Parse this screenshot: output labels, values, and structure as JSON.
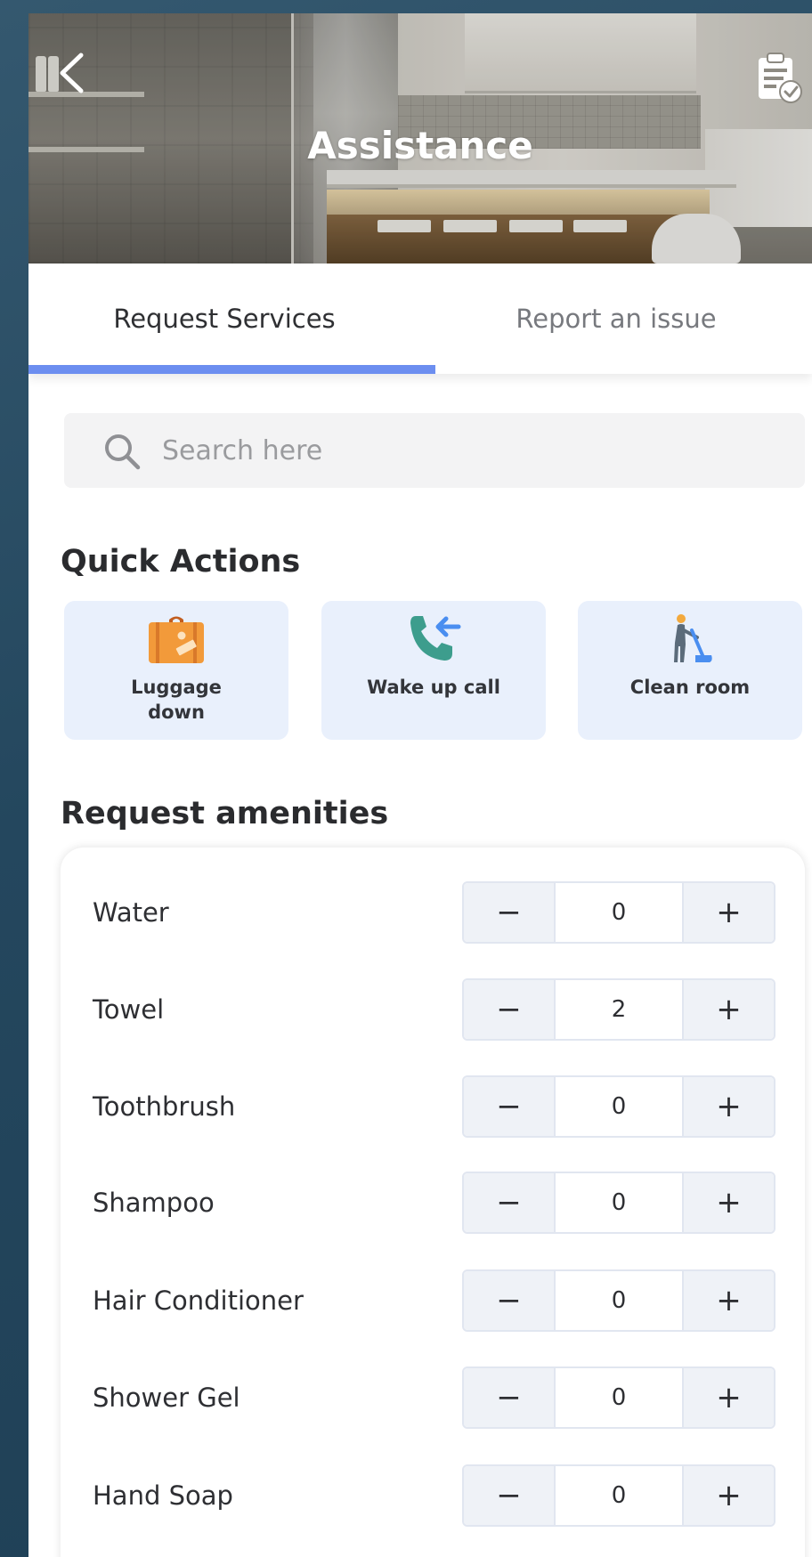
{
  "header": {
    "title": "Assistance",
    "back_icon": "chevron-left-icon",
    "action_icon": "clipboard-check-icon"
  },
  "tabs": [
    {
      "label": "Request Services",
      "active": true
    },
    {
      "label": "Report an issue",
      "active": false
    }
  ],
  "search": {
    "placeholder": "Search here",
    "value": ""
  },
  "quick_actions": {
    "title": "Quick Actions",
    "items": [
      {
        "label": "Luggage down",
        "icon": "luggage-icon"
      },
      {
        "label": "Wake up call",
        "icon": "phone-incoming-icon"
      },
      {
        "label": "Clean room",
        "icon": "vacuum-cleaning-icon"
      }
    ]
  },
  "amenities": {
    "title": "Request amenities",
    "items": [
      {
        "name": "Water",
        "qty": "0"
      },
      {
        "name": "Towel",
        "qty": "2"
      },
      {
        "name": "Toothbrush",
        "qty": "0"
      },
      {
        "name": "Shampoo",
        "qty": "0"
      },
      {
        "name": "Hair Conditioner",
        "qty": "0"
      },
      {
        "name": "Shower Gel",
        "qty": "0"
      },
      {
        "name": "Hand Soap",
        "qty": "0"
      }
    ],
    "minus_label": "−",
    "plus_label": "+"
  },
  "colors": {
    "accent": "#6c8ef0",
    "quick_action_bg": "#e9f0fc",
    "stepper_bg": "#eff2f7"
  }
}
